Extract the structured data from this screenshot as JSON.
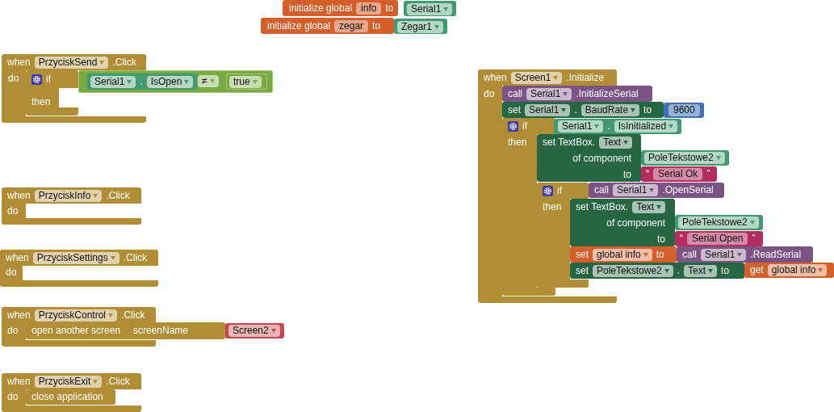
{
  "workspace": {
    "blocks": [
      {
        "kind": "variable",
        "rows": [
          {
            "parts": [
              {
                "kind": "label",
                "text": "initialize global"
              },
              {
                "kind": "field",
                "text": "info"
              },
              {
                "kind": "label",
                "text": "to"
              }
            ]
          }
        ],
        "inputs": [
          {
            "kind": "component",
            "rows": [
              {
                "parts": [
                  {
                    "kind": "dropdown",
                    "text": "Serial1"
                  }
                ]
              }
            ]
          }
        ]
      },
      {
        "kind": "variable",
        "rows": [
          {
            "parts": [
              {
                "kind": "label",
                "text": "initialize global"
              },
              {
                "kind": "field",
                "text": "zegar"
              },
              {
                "kind": "label",
                "text": "to"
              }
            ]
          }
        ],
        "inputs": [
          {
            "kind": "component",
            "rows": [
              {
                "parts": [
                  {
                    "kind": "dropdown",
                    "text": "Zegar1"
                  }
                ]
              }
            ]
          }
        ]
      },
      {
        "kind": "event",
        "rows": [
          {
            "parts": [
              {
                "kind": "label",
                "text": "when"
              },
              {
                "kind": "dropdown",
                "text": "PrzyciskSend"
              },
              {
                "kind": "label",
                "text": ".Click"
              }
            ]
          },
          {
            "parts": [
              {
                "kind": "label",
                "text": "do"
              }
            ]
          }
        ],
        "body": [
          {
            "kind": "control",
            "rows": [
              {
                "parts": [
                  {
                    "kind": "gear"
                  },
                  {
                    "kind": "label",
                    "text": "if"
                  }
                ]
              },
              {
                "parts": [
                  {
                    "kind": "label",
                    "text": "then"
                  }
                ]
              }
            ],
            "inputs": [
              {
                "kind": "logic",
                "rows": [
                  {
                    "parts": [
                      {
                        "kind": "dropdown",
                        "text": "≠"
                      }
                    ]
                  }
                ],
                "inputs": [
                  {
                    "kind": "component",
                    "rows": [
                      {
                        "parts": [
                          {
                            "kind": "dropdown",
                            "text": "Serial1"
                          },
                          {
                            "kind": "label",
                            "text": "."
                          },
                          {
                            "kind": "dropdown",
                            "text": "IsOpen"
                          }
                        ]
                      }
                    ]
                  },
                  {
                    "kind": "logic",
                    "rows": [
                      {
                        "parts": [
                          {
                            "kind": "dropdown",
                            "text": "true"
                          }
                        ]
                      }
                    ]
                  }
                ]
              }
            ]
          }
        ]
      },
      {
        "kind": "event",
        "rows": [
          {
            "parts": [
              {
                "kind": "label",
                "text": "when"
              },
              {
                "kind": "dropdown",
                "text": "PrzyciskInfo"
              },
              {
                "kind": "label",
                "text": ".Click"
              }
            ]
          },
          {
            "parts": [
              {
                "kind": "label",
                "text": "do"
              }
            ]
          }
        ]
      },
      {
        "kind": "event",
        "rows": [
          {
            "parts": [
              {
                "kind": "label",
                "text": "when"
              },
              {
                "kind": "dropdown",
                "text": "PrzyciskSettings"
              },
              {
                "kind": "label",
                "text": ".Click"
              }
            ]
          },
          {
            "parts": [
              {
                "kind": "label",
                "text": "do"
              }
            ]
          }
        ]
      },
      {
        "kind": "event",
        "rows": [
          {
            "parts": [
              {
                "kind": "label",
                "text": "when"
              },
              {
                "kind": "dropdown",
                "text": "PrzyciskControl"
              },
              {
                "kind": "label",
                "text": ".Click"
              }
            ]
          },
          {
            "parts": [
              {
                "kind": "label",
                "text": "do"
              }
            ]
          }
        ],
        "body": [
          {
            "kind": "control",
            "rows": [
              {
                "parts": [
                  {
                    "kind": "label",
                    "text": "open another screen"
                  }
                ]
              },
              {
                "parts": [
                  {
                    "kind": "label",
                    "text": "screenName"
                  }
                ]
              }
            ],
            "inputs": [
              {
                "kind": "screen",
                "rows": [
                  {
                    "parts": [
                      {
                        "kind": "dropdown",
                        "text": "Screen2"
                      }
                    ]
                  }
                ]
              }
            ]
          }
        ]
      },
      {
        "kind": "event",
        "rows": [
          {
            "parts": [
              {
                "kind": "label",
                "text": "when"
              },
              {
                "kind": "dropdown",
                "text": "PrzyciskExit"
              },
              {
                "kind": "label",
                "text": ".Click"
              }
            ]
          },
          {
            "parts": [
              {
                "kind": "label",
                "text": "do"
              }
            ]
          }
        ],
        "body": [
          {
            "kind": "control",
            "rows": [
              {
                "parts": [
                  {
                    "kind": "label",
                    "text": "close application"
                  }
                ]
              }
            ]
          }
        ]
      },
      {
        "kind": "event",
        "rows": [
          {
            "parts": [
              {
                "kind": "label",
                "text": "when"
              },
              {
                "kind": "dropdown",
                "text": "Screen1"
              },
              {
                "kind": "label",
                "text": ".Initialize"
              }
            ]
          },
          {
            "parts": [
              {
                "kind": "label",
                "text": "do"
              }
            ]
          }
        ],
        "body": [
          {
            "kind": "method",
            "rows": [
              {
                "parts": [
                  {
                    "kind": "label",
                    "text": "call"
                  },
                  {
                    "kind": "dropdown",
                    "text": "Serial1"
                  },
                  {
                    "kind": "label",
                    "text": ".InitializeSerial"
                  }
                ]
              }
            ]
          },
          {
            "kind": "setter",
            "rows": [
              {
                "parts": [
                  {
                    "kind": "label",
                    "text": "set"
                  },
                  {
                    "kind": "dropdown",
                    "text": "Serial1"
                  },
                  {
                    "kind": "label",
                    "text": "."
                  },
                  {
                    "kind": "dropdown",
                    "text": "BaudRate"
                  },
                  {
                    "kind": "label",
                    "text": "to"
                  }
                ]
              }
            ],
            "inputs": [
              {
                "kind": "math",
                "rows": [
                  {
                    "parts": [
                      {
                        "kind": "field",
                        "text": "9600"
                      }
                    ]
                  }
                ]
              }
            ]
          },
          {
            "kind": "control",
            "rows": [
              {
                "parts": [
                  {
                    "kind": "gear"
                  },
                  {
                    "kind": "label",
                    "text": "if"
                  }
                ]
              },
              {
                "parts": [
                  {
                    "kind": "label",
                    "text": "then"
                  }
                ]
              }
            ],
            "inputs": [
              {
                "kind": "component",
                "rows": [
                  {
                    "parts": [
                      {
                        "kind": "dropdown",
                        "text": "Serial1"
                      },
                      {
                        "kind": "label",
                        "text": "."
                      },
                      {
                        "kind": "dropdown",
                        "text": "IsInitialized"
                      }
                    ]
                  }
                ]
              }
            ],
            "body": [
              {
                "kind": "setter",
                "rows": [
                  {
                    "parts": [
                      {
                        "kind": "label",
                        "text": "set TextBox."
                      },
                      {
                        "kind": "dropdown",
                        "text": "Text"
                      }
                    ]
                  },
                  {
                    "parts": [
                      {
                        "kind": "label",
                        "text": "of component"
                      }
                    ]
                  },
                  {
                    "parts": [
                      {
                        "kind": "label",
                        "text": "to"
                      }
                    ]
                  }
                ],
                "inputs": [
                  {
                    "kind": "component",
                    "rows": [
                      {
                        "parts": [
                          {
                            "kind": "dropdown",
                            "text": "PoleTekstowe2"
                          }
                        ]
                      }
                    ]
                  },
                  {
                    "kind": "text",
                    "rows": [
                      {
                        "parts": [
                          {
                            "kind": "label",
                            "text": "“"
                          },
                          {
                            "kind": "field",
                            "text": "Serial Ok"
                          },
                          {
                            "kind": "label",
                            "text": "”"
                          }
                        ]
                      }
                    ]
                  }
                ]
              },
              {
                "kind": "control",
                "rows": [
                  {
                    "parts": [
                      {
                        "kind": "gear"
                      },
                      {
                        "kind": "label",
                        "text": "if"
                      }
                    ]
                  },
                  {
                    "parts": [
                      {
                        "kind": "label",
                        "text": "then"
                      }
                    ]
                  }
                ],
                "inputs": [
                  {
                    "kind": "method",
                    "rows": [
                      {
                        "parts": [
                          {
                            "kind": "label",
                            "text": "call"
                          },
                          {
                            "kind": "dropdown",
                            "text": "Serial1"
                          },
                          {
                            "kind": "label",
                            "text": ".OpenSerial"
                          }
                        ]
                      }
                    ]
                  }
                ],
                "body": [
                  {
                    "kind": "setter",
                    "rows": [
                      {
                        "parts": [
                          {
                            "kind": "label",
                            "text": "set TextBox."
                          },
                          {
                            "kind": "dropdown",
                            "text": "Text"
                          }
                        ]
                      },
                      {
                        "parts": [
                          {
                            "kind": "label",
                            "text": "of component"
                          }
                        ]
                      },
                      {
                        "parts": [
                          {
                            "kind": "label",
                            "text": "to"
                          }
                        ]
                      }
                    ],
                    "inputs": [
                      {
                        "kind": "component",
                        "rows": [
                          {
                            "parts": [
                              {
                                "kind": "dropdown",
                                "text": "PoleTekstowe2"
                              }
                            ]
                          }
                        ]
                      },
                      {
                        "kind": "text",
                        "rows": [
                          {
                            "parts": [
                              {
                                "kind": "label",
                                "text": "“"
                              },
                              {
                                "kind": "field",
                                "text": "Serial Open"
                              },
                              {
                                "kind": "label",
                                "text": "”"
                              }
                            ]
                          }
                        ]
                      }
                    ]
                  },
                  {
                    "kind": "variable",
                    "rows": [
                      {
                        "parts": [
                          {
                            "kind": "label",
                            "text": "set"
                          },
                          {
                            "kind": "dropdown",
                            "text": "global info"
                          },
                          {
                            "kind": "label",
                            "text": "to"
                          }
                        ]
                      }
                    ],
                    "inputs": [
                      {
                        "kind": "method",
                        "rows": [
                          {
                            "parts": [
                              {
                                "kind": "label",
                                "text": "call"
                              },
                              {
                                "kind": "dropdown",
                                "text": "Serial1"
                              },
                              {
                                "kind": "label",
                                "text": ".ReadSerial"
                              }
                            ]
                          }
                        ]
                      }
                    ]
                  },
                  {
                    "kind": "setter",
                    "rows": [
                      {
                        "parts": [
                          {
                            "kind": "label",
                            "text": "set"
                          },
                          {
                            "kind": "dropdown",
                            "text": "PoleTekstowe2"
                          },
                          {
                            "kind": "label",
                            "text": "."
                          },
                          {
                            "kind": "dropdown",
                            "text": "Text"
                          },
                          {
                            "kind": "label",
                            "text": "to"
                          }
                        ]
                      }
                    ],
                    "inputs": [
                      {
                        "kind": "variable",
                        "rows": [
                          {
                            "parts": [
                              {
                                "kind": "label",
                                "text": "get"
                              },
                              {
                                "kind": "dropdown",
                                "text": "global info"
                              }
                            ]
                          }
                        ]
                      }
                    ]
                  }
                ]
              }
            ]
          }
        ]
      }
    ]
  }
}
